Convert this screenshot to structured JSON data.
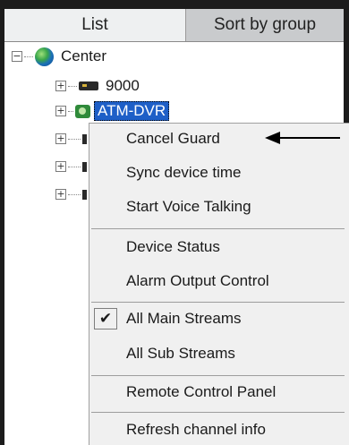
{
  "tabs": [
    {
      "label": "List",
      "active": true
    },
    {
      "label": "Sort by group",
      "active": false
    }
  ],
  "tree": {
    "root": {
      "label": "Center",
      "expander": "−",
      "icon": "globe-icon"
    },
    "children": [
      {
        "label": "9000",
        "expander": "+",
        "icon": "dvr-icon"
      },
      {
        "label": "ATM-DVR",
        "expander": "+",
        "icon": "camera-device-icon",
        "selected": true
      }
    ],
    "hidden_rows_expanders": [
      "+",
      "+",
      "+"
    ]
  },
  "context_menu": {
    "items": [
      {
        "label": "Cancel Guard"
      },
      {
        "label": "Sync device time"
      },
      {
        "label": "Start Voice Talking"
      },
      {
        "label": "Device Status"
      },
      {
        "label": "Alarm Output Control"
      },
      {
        "label": "All Main Streams",
        "checked": true,
        "check_glyph": "✔"
      },
      {
        "label": "All Sub Streams"
      },
      {
        "label": "Remote Control Panel"
      },
      {
        "label": "Refresh channel info"
      }
    ]
  },
  "annotation": {
    "icon": "arrow-left-icon",
    "points_to": "Cancel Guard"
  },
  "colors": {
    "selection": "#1e5fc7",
    "tab_active": "#eef0f1",
    "tab_inactive": "#c9cbcd",
    "menu_bg": "#f0f0f0"
  }
}
